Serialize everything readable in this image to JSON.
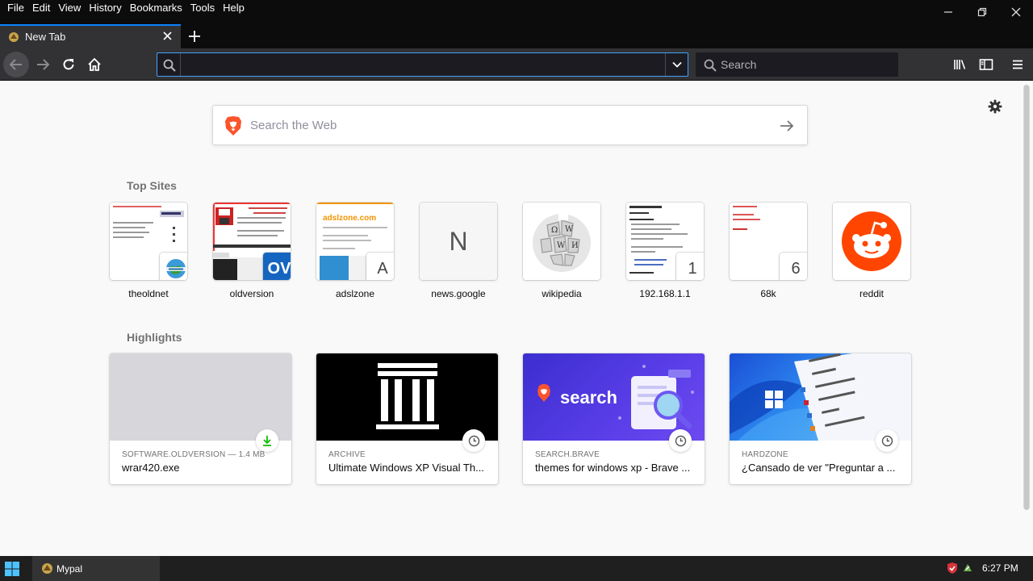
{
  "menubar": {
    "items": [
      {
        "label": "File"
      },
      {
        "label": "Edit"
      },
      {
        "label": "View"
      },
      {
        "label": "History"
      },
      {
        "label": "Bookmarks"
      },
      {
        "label": "Tools"
      },
      {
        "label": "Help"
      }
    ]
  },
  "tab": {
    "title": "New Tab"
  },
  "toolbar": {
    "search_placeholder": "Search"
  },
  "newtab": {
    "web_search_placeholder": "Search the Web",
    "top_sites_title": "Top Sites",
    "highlights_title": "Highlights",
    "top_sites": [
      {
        "label": "theoldnet"
      },
      {
        "label": "oldversion"
      },
      {
        "label": "adslzone",
        "badge": "A"
      },
      {
        "label": "news.google",
        "letter": "N"
      },
      {
        "label": "wikipedia"
      },
      {
        "label": "192.168.1.1",
        "badge": "1"
      },
      {
        "label": "68k",
        "badge": "6"
      },
      {
        "label": "reddit"
      }
    ],
    "highlights": [
      {
        "source": "SOFTWARE.OLDVERSION — 1.4 MB",
        "title": "wrar420.exe"
      },
      {
        "source": "ARCHIVE",
        "title": "Ultimate Windows XP Visual Th..."
      },
      {
        "source": "SEARCH.BRAVE",
        "title": "themes for windows xp - Brave ...",
        "image_text": "search"
      },
      {
        "source": "HARDZONE",
        "title": "¿Cansado de ver \"Preguntar a ..."
      }
    ],
    "thumb_texts": {
      "adslzone": "adslzone.com",
      "oldversion_badge": "OV"
    }
  },
  "taskbar": {
    "app_label": "Mypal",
    "clock": "6:27 PM"
  },
  "colors": {
    "accent": "#0a84ff",
    "reddit": "#ff4500",
    "brave": "#fb542b"
  }
}
